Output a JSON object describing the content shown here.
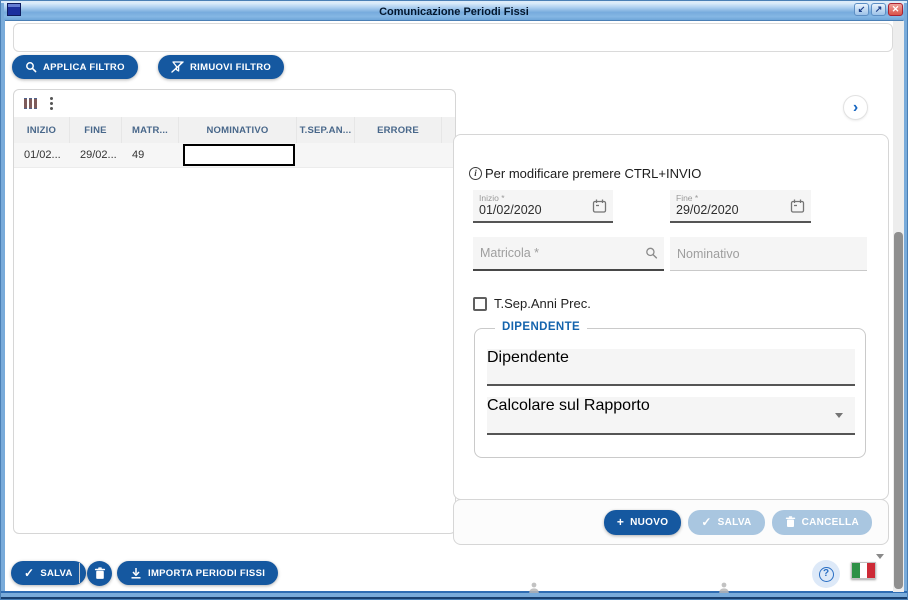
{
  "window": {
    "title": "Comunicazione Periodi Fissi",
    "restore_glyph": "↙",
    "maximize_glyph": "↗",
    "close_glyph": "✕"
  },
  "filters": {
    "apply": "APPLICA FILTRO",
    "remove": "RIMUOVI FILTRO"
  },
  "grid": {
    "headers": [
      "INIZIO",
      "FINE",
      "MATR...",
      "NOMINATIVO",
      "T.SEP.AN...",
      "ERRORE"
    ],
    "row": [
      "01/02...",
      "29/02...",
      "49",
      "",
      "",
      ""
    ]
  },
  "form": {
    "info": "Per modificare premere CTRL+INVIO",
    "inizio_label": "Inizio *",
    "inizio_value": "01/02/2020",
    "fine_label": "Fine *",
    "fine_value": "29/02/2020",
    "matricola_label": "Matricola *",
    "nominativo_placeholder": "Nominativo",
    "checkbox_label": "T.Sep.Anni Prec.",
    "legend": "DIPENDENTE",
    "dipendente_placeholder": "Dipendente",
    "rapporto_placeholder": "Calcolare sul Rapporto",
    "nuovo_label": "NUOVO",
    "salva_label": "SALVA",
    "cancella_label": "CANCELLA"
  },
  "footer": {
    "salva": "SALVA",
    "importa": "IMPORTA PERIODI FISSI"
  },
  "glyphs": {
    "info": "i",
    "plus": "+",
    "check": "✓",
    "chevron": "›",
    "question": "?"
  },
  "colors": {
    "primary": "#1558a0",
    "disabled": "#a9c6e0",
    "legend_blue": "#1464ad",
    "flag_green": "#2f9147",
    "flag_white": "#ffffff",
    "flag_red": "#cd2a36"
  }
}
